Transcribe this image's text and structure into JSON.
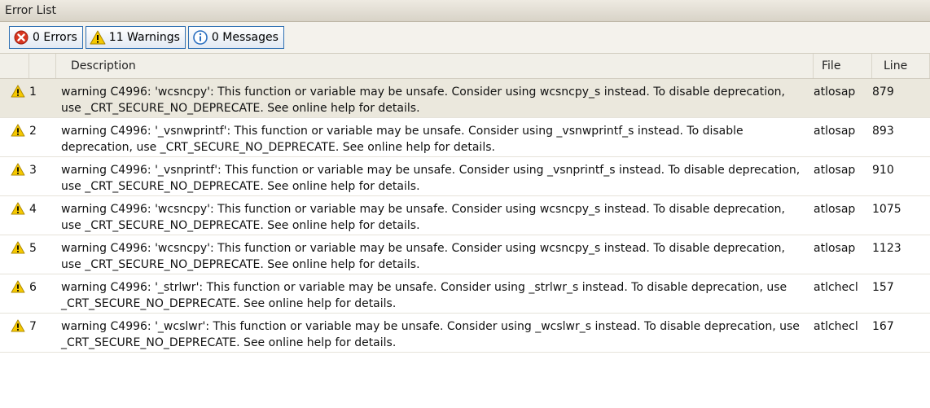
{
  "window": {
    "title": "Error List"
  },
  "toolbar": {
    "errors_label": "0 Errors",
    "warnings_label": "11 Warnings",
    "messages_label": "0 Messages"
  },
  "columns": {
    "description": "Description",
    "file": "File",
    "line": "Line"
  },
  "colors": {
    "warning": "#f5c800",
    "error": "#d8351f",
    "info": "#2a6ebf",
    "selected_row": "#ebe8dd"
  },
  "rows": [
    {
      "icon": "warning-icon",
      "num": "1",
      "description": "warning C4996: 'wcsncpy': This function or variable may be unsafe. Consider using wcsncpy_s instead. To disable deprecation, use _CRT_SECURE_NO_DEPRECATE. See online help for details.",
      "file": "atlosap",
      "line": "879"
    },
    {
      "icon": "warning-icon",
      "num": "2",
      "description": "warning C4996: '_vsnwprintf': This function or variable may be unsafe. Consider using _vsnwprintf_s instead. To disable deprecation, use _CRT_SECURE_NO_DEPRECATE. See online help for details.",
      "file": "atlosap",
      "line": "893"
    },
    {
      "icon": "warning-icon",
      "num": "3",
      "description": "warning C4996: '_vsnprintf': This function or variable may be unsafe. Consider using _vsnprintf_s instead. To disable deprecation, use _CRT_SECURE_NO_DEPRECATE. See online help for details.",
      "file": "atlosap",
      "line": "910"
    },
    {
      "icon": "warning-icon",
      "num": "4",
      "description": "warning C4996: 'wcsncpy': This function or variable may be unsafe. Consider using wcsncpy_s instead. To disable deprecation, use _CRT_SECURE_NO_DEPRECATE. See online help for details.",
      "file": "atlosap",
      "line": "1075"
    },
    {
      "icon": "warning-icon",
      "num": "5",
      "description": "warning C4996: 'wcsncpy': This function or variable may be unsafe. Consider using wcsncpy_s instead. To disable deprecation, use _CRT_SECURE_NO_DEPRECATE. See online help for details.",
      "file": "atlosap",
      "line": "1123"
    },
    {
      "icon": "warning-icon",
      "num": "6",
      "description": "warning C4996: '_strlwr': This function or variable may be unsafe. Consider using _strlwr_s instead. To disable deprecation, use _CRT_SECURE_NO_DEPRECATE. See online help for details.",
      "file": "atlchecl",
      "line": "157"
    },
    {
      "icon": "warning-icon",
      "num": "7",
      "description": "warning C4996: '_wcslwr': This function or variable may be unsafe. Consider using _wcslwr_s instead. To disable deprecation, use _CRT_SECURE_NO_DEPRECATE. See online help for details.",
      "file": "atlchecl",
      "line": "167"
    }
  ]
}
